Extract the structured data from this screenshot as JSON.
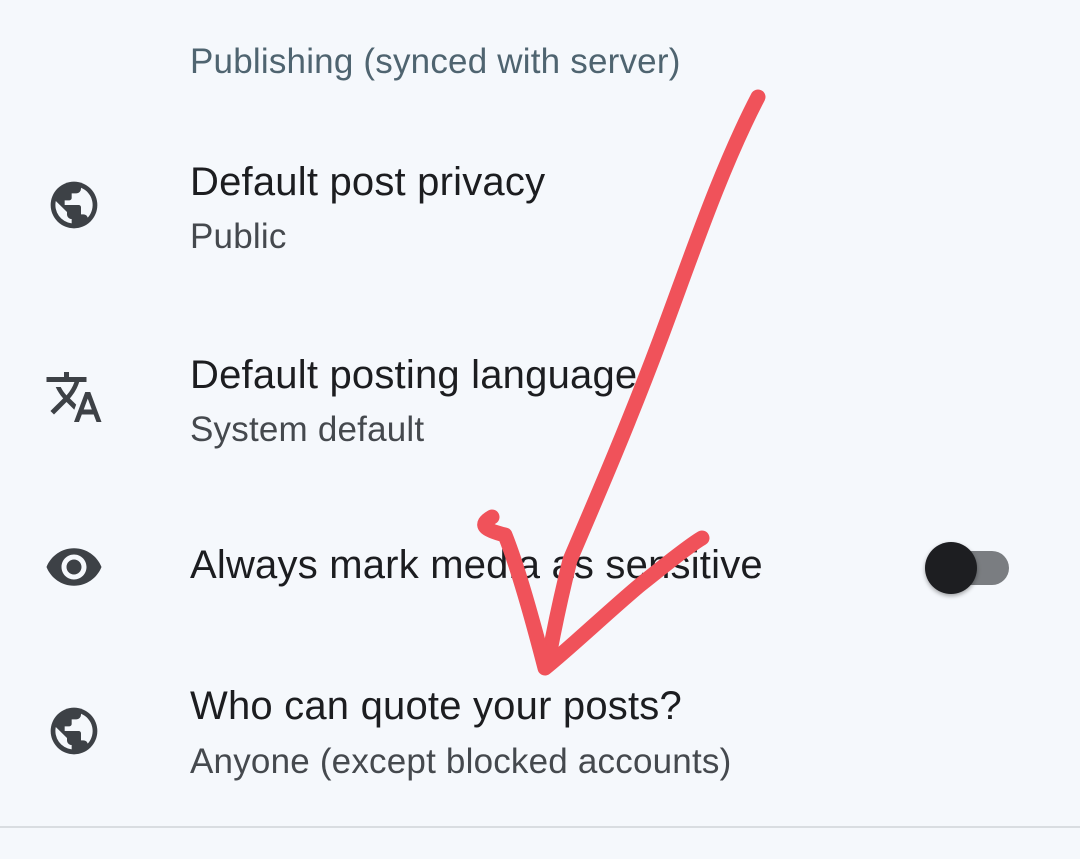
{
  "section_header": "Publishing (synced with server)",
  "settings": {
    "privacy": {
      "title": "Default post privacy",
      "value": "Public",
      "icon": "globe-icon"
    },
    "language": {
      "title": "Default posting language",
      "value": "System default",
      "icon": "translate-icon"
    },
    "sensitive": {
      "title": "Always mark media as sensitive",
      "icon": "eye-icon",
      "enabled": false
    },
    "quote": {
      "title": "Who can quote your posts?",
      "value": "Anyone (except blocked accounts)",
      "icon": "globe-icon"
    }
  },
  "colors": {
    "background": "#f5f8fc",
    "annotation_arrow": "#f0525a",
    "section_header": "#4f6470"
  }
}
